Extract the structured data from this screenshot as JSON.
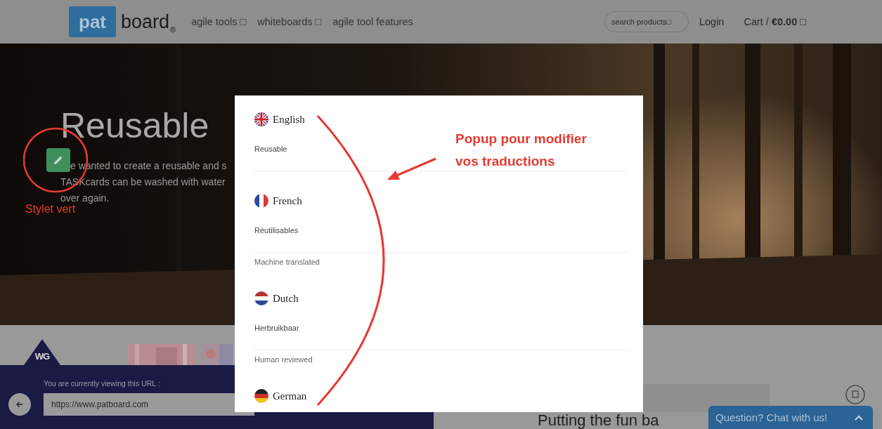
{
  "header": {
    "logo": {
      "part_1": "pat",
      "part_2": "board",
      "mark": "®"
    },
    "nav": [
      "agile tools □",
      "whiteboards □",
      "agile tool features"
    ],
    "search": {
      "placeholder": "search products□"
    },
    "login": "Login",
    "cart": "Cart / **€0.00** □"
  },
  "hero": {
    "title": "Reusable",
    "lines": [
      "e wanted to create a reusable and s",
      "TASKcards can be washed with water",
      "over again."
    ]
  },
  "translation_popup": {
    "languages": [
      {
        "name": "English",
        "kind": "uk",
        "translation": "Reusable"
      },
      {
        "name": "French",
        "kind": "fr",
        "translation": "Réutilisables",
        "status": "Machine translated"
      },
      {
        "name": "Dutch",
        "kind": "nl",
        "translation": "Herbruikbaar",
        "status": "Human reviewed"
      },
      {
        "name": "German",
        "kind": "de"
      }
    ]
  },
  "url_bar": {
    "logo": "WG",
    "label": "You are currently viewing this URL :",
    "url": "https://www.patboard.com"
  },
  "section_heading": "Putting the fun ba",
  "chat": {
    "label": "Question? Chat with us!"
  },
  "annotations": {
    "popup_note": "Popup pour modifier vos traductions",
    "pencil_note": "Stylet vert"
  }
}
